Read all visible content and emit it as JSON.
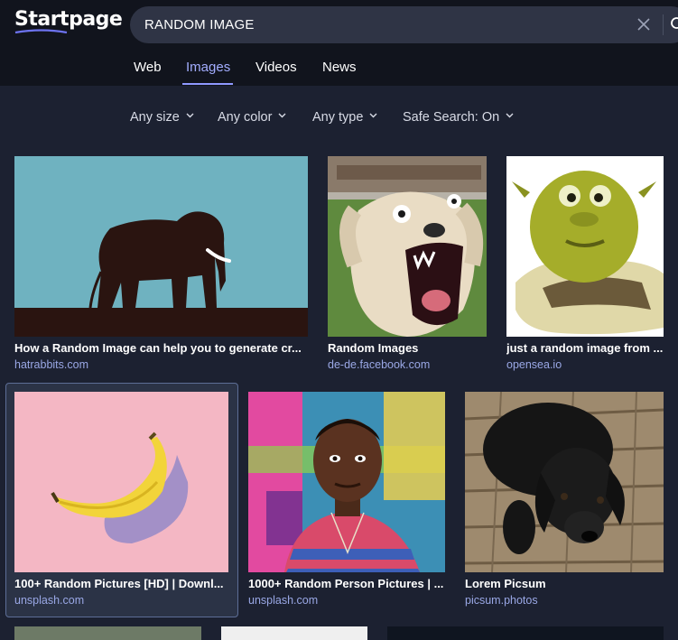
{
  "header": {
    "logo_text": "Startpage",
    "search": {
      "value": "RANDOM IMAGE"
    }
  },
  "tabs": [
    {
      "label": "Web",
      "active": false
    },
    {
      "label": "Images",
      "active": true
    },
    {
      "label": "Videos",
      "active": false
    },
    {
      "label": "News",
      "active": false
    }
  ],
  "filters": [
    {
      "label": "Any size"
    },
    {
      "label": "Any color"
    },
    {
      "label": "Any type"
    },
    {
      "label": "Safe Search: On"
    }
  ],
  "results": [
    {
      "title": "How a Random Image can help you to generate cr...",
      "domain": "hatrabbits.com",
      "image": "elephant-silhouette"
    },
    {
      "title": "Random Images",
      "domain": "de-de.facebook.com",
      "image": "screaming-dog"
    },
    {
      "title": "just a random image from ...",
      "domain": "opensea.io",
      "image": "green-ogre-face"
    },
    {
      "title": "100+ Random Pictures [HD] | Downl...",
      "domain": "unsplash.com",
      "image": "banana-on-pink",
      "selected": true
    },
    {
      "title": "1000+ Random Person Pictures | ...",
      "domain": "unsplash.com",
      "image": "man-portrait-graffiti"
    },
    {
      "title": "Lorem Picsum",
      "domain": "picsum.photos",
      "image": "black-puppy"
    }
  ],
  "colors": {
    "background": "#1c2131",
    "header": "#11141d",
    "accent": "#a3adff",
    "domain": "#9aa8e6"
  }
}
